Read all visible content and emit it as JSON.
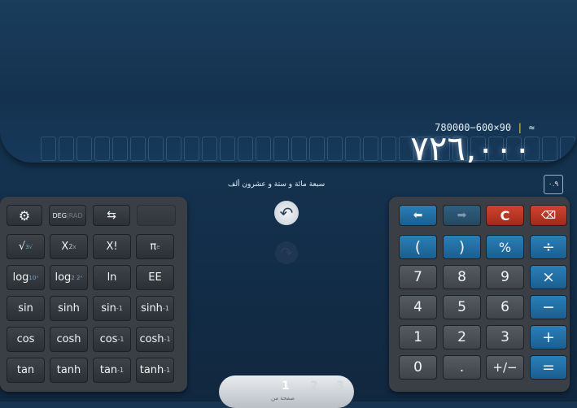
{
  "display": {
    "expression": "780000−600×90",
    "approx": "≈",
    "result": "٧٢٦,٠٠٠",
    "words": "سبعة مائة و ستة و عشرون ألف",
    "mode_button": "٠.٩"
  },
  "toolbar": {
    "angle_mode": "DEG",
    "angle_mode_alt": "RAD"
  },
  "scientific_keys": [
    {
      "name": "sqrt-button",
      "label": "√",
      "sup": "",
      "sub": "3√"
    },
    {
      "name": "square-button",
      "label": "X",
      "sup": "2",
      "sub": "x"
    },
    {
      "name": "factorial-button",
      "label": "X!",
      "sup": "",
      "sub": ""
    },
    {
      "name": "pi-button",
      "label": "π",
      "sup": "",
      "sub": "e"
    },
    {
      "name": "log-button",
      "label": "log",
      "sup": "",
      "sub": "10ˣ"
    },
    {
      "name": "log2-button",
      "label": "log",
      "sup": "",
      "sub": "2  2ˣ"
    },
    {
      "name": "ln-button",
      "label": "ln",
      "sup": "",
      "sub": ""
    },
    {
      "name": "ee-button",
      "label": "EE",
      "sup": "",
      "sub": ""
    },
    {
      "name": "sin-button",
      "label": "sin",
      "sup": "",
      "sub": ""
    },
    {
      "name": "sinh-button",
      "label": "sinh",
      "sup": "",
      "sub": ""
    },
    {
      "name": "asin-button",
      "label": "sin",
      "sup": "-1",
      "sub": ""
    },
    {
      "name": "asinh-button",
      "label": "sinh",
      "sup": "-1",
      "sub": ""
    },
    {
      "name": "cos-button",
      "label": "cos",
      "sup": "",
      "sub": ""
    },
    {
      "name": "cosh-button",
      "label": "cosh",
      "sup": "",
      "sub": ""
    },
    {
      "name": "acos-button",
      "label": "cos",
      "sup": "-1",
      "sub": ""
    },
    {
      "name": "acosh-button",
      "label": "cosh",
      "sup": "-1",
      "sub": ""
    },
    {
      "name": "tan-button",
      "label": "tan",
      "sup": "",
      "sub": ""
    },
    {
      "name": "tanh-button",
      "label": "tanh",
      "sup": "",
      "sub": ""
    },
    {
      "name": "atan-button",
      "label": "tan",
      "sup": "-1",
      "sub": ""
    },
    {
      "name": "atanh-button",
      "label": "tanh",
      "sup": "-1",
      "sub": ""
    }
  ],
  "keypad": {
    "clear": "C",
    "open_paren": "(",
    "close_paren": ")",
    "percent": "%",
    "divide": "÷",
    "multiply": "×",
    "minus": "−",
    "plus": "+",
    "equals": "=",
    "decimal": ".",
    "negate": "+/−",
    "digits": [
      "0",
      "1",
      "2",
      "3",
      "4",
      "5",
      "6",
      "7",
      "8",
      "9"
    ]
  },
  "pager": {
    "pages": [
      "1",
      "2",
      "3"
    ],
    "label": "صفحة من"
  },
  "colors": {
    "accent_blue": "#2a7fb8",
    "clear_red": "#c0392b",
    "cursor_yellow": "#f2d04a"
  }
}
